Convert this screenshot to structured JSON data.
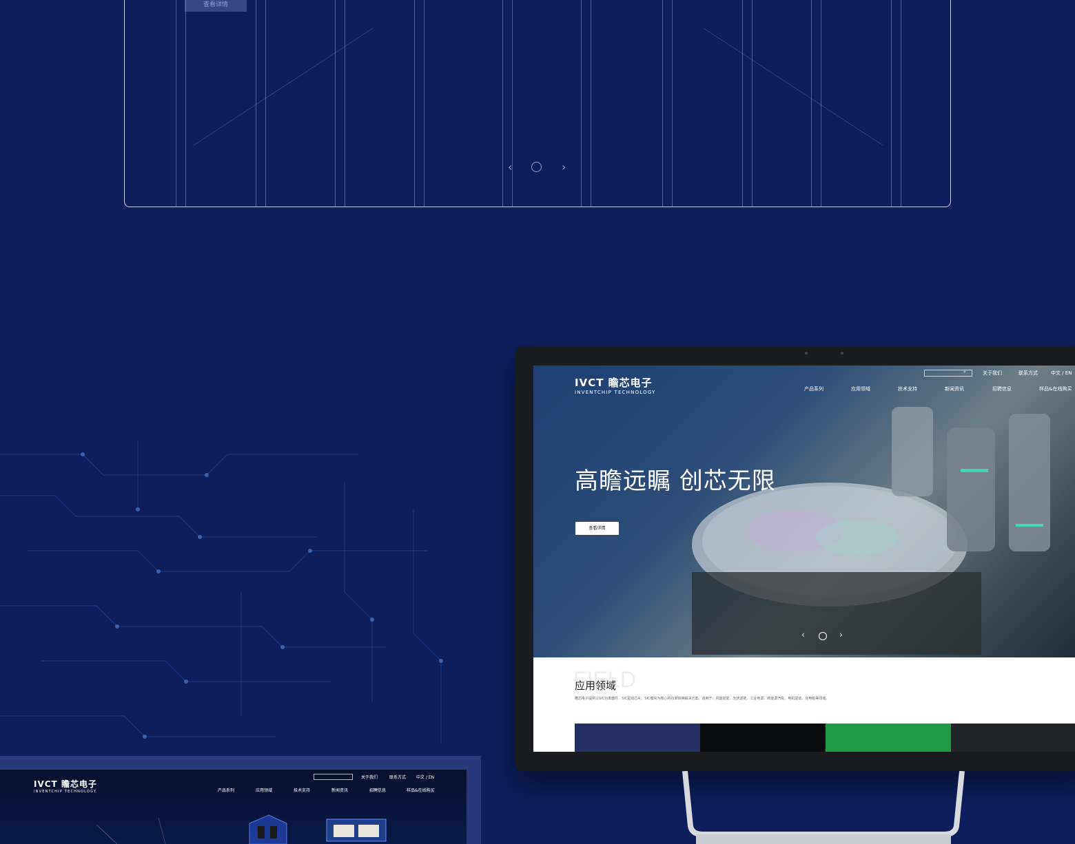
{
  "top_panel": {
    "detail_button": "查看详情",
    "prev_symbol": "‹",
    "next_symbol": "›"
  },
  "monitor": {
    "brand": {
      "logo": "IVCT",
      "name": "瞻芯电子",
      "subtitle": "INVENTCHIP TECHNOLOGY"
    },
    "utility_links": [
      "关于我们",
      "联系方式",
      "中文 / EN"
    ],
    "nav": [
      "产品系列",
      "应用领域",
      "技术支持",
      "新闻资讯",
      "招聘信息",
      "样品&在线购买"
    ],
    "hero": {
      "headline": "高瞻远瞩 创芯无限",
      "button": "查看详情",
      "prev_symbol": "‹",
      "next_symbol": "›"
    },
    "field_section": {
      "bg_text": "FIELD",
      "title": "应用领域",
      "description": "瞻芯电子提供以SIC功率器件、SIC驱动芯片、SIC模块为核心的功率转换解决方案。适用于：风能逆变、光伏逆变、工业电源、新能源汽车、电机驱动、充电桩等领域。"
    },
    "tile_colors": [
      "#262f63",
      "#0b0c10",
      "#1f9a46",
      "#202327"
    ]
  },
  "mock2": {
    "brand": {
      "logo": "IVCT",
      "name": "瞻芯电子",
      "subtitle": "INVENTCHIP TECHNOLOGY"
    },
    "utility_links": [
      "关于我们",
      "联系方式",
      "中文 / EN"
    ],
    "nav": [
      "产品系列",
      "应用领域",
      "技术支持",
      "新闻资讯",
      "招聘信息",
      "样品&在线购买"
    ]
  },
  "colors": {
    "background": "#0d1e5a",
    "accent_green": "#1f9a46"
  }
}
